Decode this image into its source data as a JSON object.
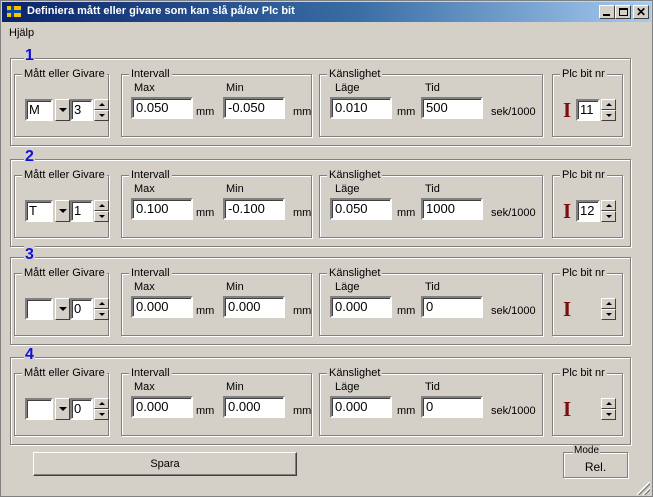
{
  "window": {
    "title": "Definiera mått eller givare som kan slå på/av Plc bit"
  },
  "menu": {
    "items": [
      "Hjälp"
    ]
  },
  "labels": {
    "matt_eller_givare": "Mått eller Givare",
    "intervall": "Intervall",
    "max": "Max",
    "min": "Min",
    "unit_mm": "mm",
    "kanslighet": "Känslighet",
    "lage": "Läge",
    "tid": "Tid",
    "unit_sek": "sek/1000",
    "plc_bit_nr": "Plc bit nr",
    "plc_indicator": "I"
  },
  "rows": [
    {
      "number": "1",
      "type": "M",
      "index": "3",
      "max": "0.050",
      "min": "-0.050",
      "lage": "0.010",
      "tid": "500",
      "plc_bit": "11"
    },
    {
      "number": "2",
      "type": "T",
      "index": "1",
      "max": "0.100",
      "min": "-0.100",
      "lage": "0.050",
      "tid": "1000",
      "plc_bit": "12"
    },
    {
      "number": "3",
      "type": "",
      "index": "0",
      "max": "0.000",
      "min": "0.000",
      "lage": "0.000",
      "tid": "0",
      "plc_bit": ""
    },
    {
      "number": "4",
      "type": "",
      "index": "0",
      "max": "0.000",
      "min": "0.000",
      "lage": "0.000",
      "tid": "0",
      "plc_bit": ""
    }
  ],
  "footer": {
    "save_label": "Spara",
    "mode_title": "Mode",
    "mode_value": "Rel."
  },
  "colors": {
    "row_number": "#1010d8",
    "plc_indicator": "#7b0f0f",
    "titlebar_start": "#0a246a",
    "titlebar_end": "#a6caf0"
  }
}
